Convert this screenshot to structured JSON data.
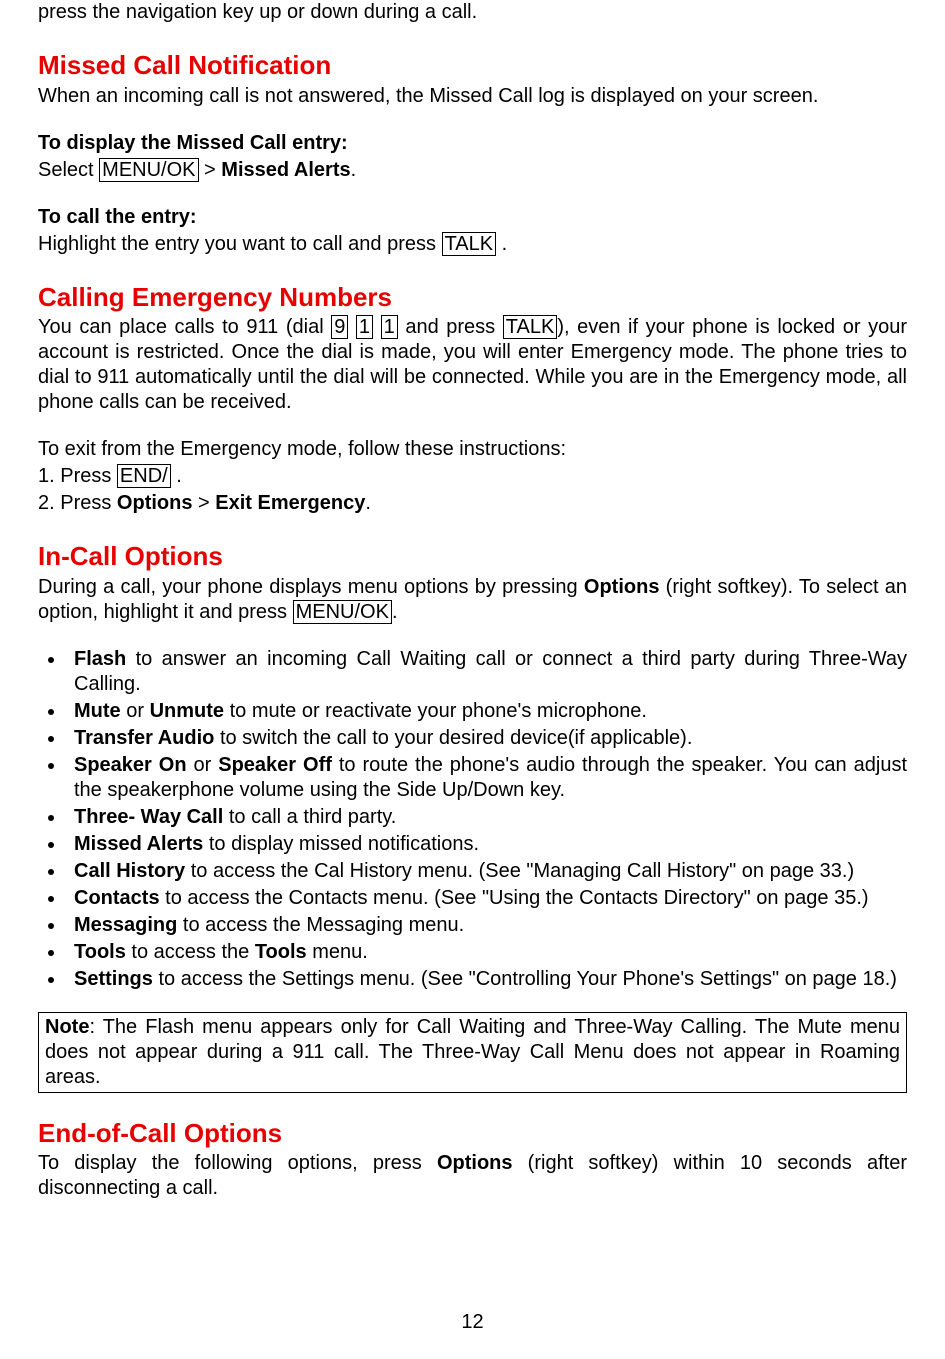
{
  "top_line": "press the navigation key up or down during a call.",
  "missed": {
    "heading": "Missed Call Notification",
    "intro": "When an incoming call is not answered, the Missed Call log is displayed on your screen.",
    "display_heading": "To display the Missed Call entry:",
    "display_line_prefix": "Select ",
    "menu_ok": "MENU/OK",
    "gt": " > ",
    "missed_alerts": "Missed Alerts",
    "period": ".",
    "call_heading": "To call the entry:",
    "call_line_prefix": "Highlight the entry you want to call and press ",
    "talk": "TALK",
    "call_line_suffix": " ."
  },
  "emergency": {
    "heading": "Calling Emergency Numbers",
    "p1_a": "You can place calls to 911 (dial ",
    "d9": "9",
    "d1": "1",
    "p1_b": " and press ",
    "talk": "TALK",
    "p1_c": "), even if your phone is locked or your account is restricted. Once the dial is made, you will enter Emergency mode. The phone tries to dial to 911 automatically until the dial will be connected. While you are in the Emergency mode, all phone calls can be received.",
    "exit_intro": "To exit from the Emergency mode, follow these instructions:",
    "step1_a": "1. Press ",
    "end_key": "END/",
    "step1_b": " .",
    "step2_a": "2. Press ",
    "options_word": "Options",
    "gt": " > ",
    "exit_emerg": "Exit Emergency",
    "period": "."
  },
  "incall": {
    "heading": "In-Call Options",
    "intro_a": "During a call, your phone displays menu options by pressing ",
    "options_word": "Options",
    "intro_b": " (right softkey). To select an option, highlight it and press ",
    "menu_ok": "MENU/OK",
    "intro_c": ".",
    "items": [
      {
        "bold": "Flash",
        "rest": " to answer an incoming Call Waiting call or connect a third party during Three-Way Calling."
      },
      {
        "bold": "Mute",
        "mid": " or ",
        "bold2": "Unmute",
        "rest": " to mute or reactivate your phone's microphone."
      },
      {
        "bold": "Transfer  Audio",
        "rest": " to switch the call to your desired device(if applicable)."
      },
      {
        "bold": "Speaker On",
        "mid": " or ",
        "bold2": "Speaker Off",
        "rest": " to route the phone's audio through the speaker. You can adjust the speakerphone volume using the Side Up/Down key."
      },
      {
        "bold": "Three- Way Call",
        "rest": " to call a third party."
      },
      {
        "bold": "Missed Alerts",
        "rest": " to display missed notifications."
      },
      {
        "bold": "Call History",
        "rest": " to access the Cal History menu. (See \"Managing Call History\" on page 33.)"
      },
      {
        "bold": "Contacts",
        "rest": " to access the Contacts menu. (See \"Using the Contacts Directory\" on page 35.)"
      },
      {
        "bold": "Messaging",
        "rest": " to access the Messaging menu."
      },
      {
        "bold": "Tools",
        "mid": " to access the ",
        "bold2": "Tools",
        "rest": " menu."
      },
      {
        "bold": "Settings",
        "rest": " to access the Settings menu. (See \"Controlling Your Phone's Settings\" on page 18.)"
      }
    ]
  },
  "note": {
    "label": "Note",
    "body": ": The Flash menu appears only for Call Waiting and Three-Way Calling. The Mute menu does not appear during a 911 call. The Three-Way Call Menu does not appear in Roaming areas."
  },
  "endcall": {
    "heading": "End-of-Call Options",
    "a": "To display the following options, press ",
    "options_word": "Options",
    "b": " (right softkey) within 10 seconds after disconnecting a call."
  },
  "page_number": "12"
}
